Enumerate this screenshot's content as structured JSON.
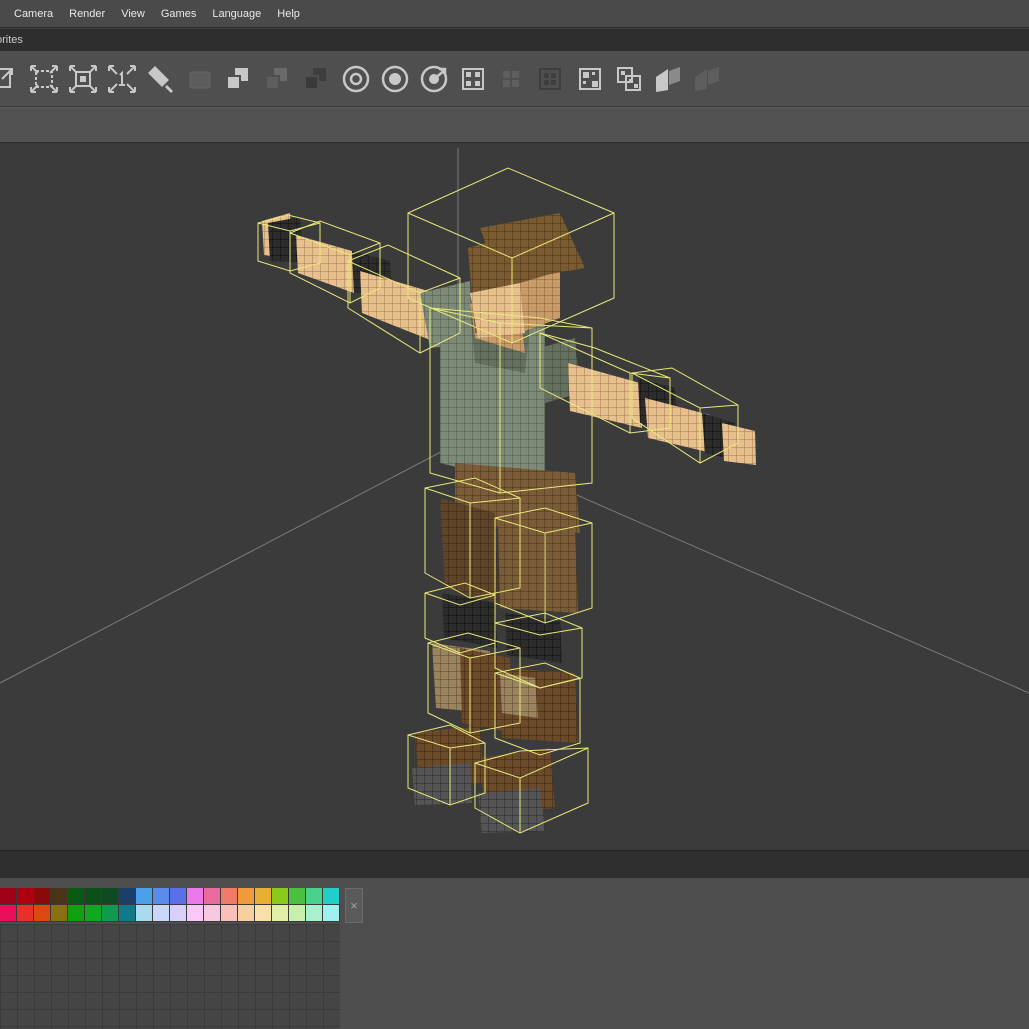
{
  "menubar": {
    "items": [
      "Camera",
      "Render",
      "View",
      "Games",
      "Language",
      "Help"
    ]
  },
  "tabbar": {
    "tab_label": "orites"
  },
  "toolbar": {
    "tools": [
      "fit-icon",
      "expand-icon",
      "scale-icon",
      "scale-one-icon",
      "brush-icon",
      "box-icon",
      "layers-icon",
      "layers-dim-icon",
      "layers-dark-icon",
      "ring-icon",
      "target-icon",
      "rotate-icon",
      "grid-select-icon",
      "grid-dim-icon",
      "grid-dark-icon",
      "grid-corner-icon",
      "grid-stack-icon",
      "plane-icon",
      "plane-dim-icon"
    ]
  },
  "palette": {
    "row1": [
      "#a00018",
      "#b00010",
      "#8a0a0a",
      "#4a3418",
      "#0a5a14",
      "#0a5018",
      "#0e4a22",
      "#18406a",
      "#4aa0ea",
      "#5a8aea",
      "#5a70ea",
      "#ea7aea",
      "#ea6a9a",
      "#f07a6a",
      "#f09a3a",
      "#e8b030",
      "#8aca1a",
      "#4ac040",
      "#4ad28a",
      "#20d0c8"
    ],
    "row2": [
      "#e8105a",
      "#e8302a",
      "#d84a10",
      "#8a7010",
      "#10a010",
      "#10a820",
      "#109a50",
      "#107a8a",
      "#aadaf0",
      "#c8d8f8",
      "#d8d0f8",
      "#f8c8f8",
      "#f8c8e0",
      "#f8c0b8",
      "#f8d0a0",
      "#f8e0a8",
      "#e0f0a8",
      "#c8f0a8",
      "#a8f0d0",
      "#a0f0f0"
    ],
    "clear_label": "×",
    "colors": {
      "panel": "#4e4e4e",
      "cell": "#454545"
    }
  },
  "colors": {
    "outline": "#e8e87a",
    "skin": "#e8c08e",
    "shirt": "#7e8a78",
    "pants": "#7a5c38",
    "boot": "#6a4a28",
    "hair": "#7a5a30",
    "sock": "#2a2a2a"
  }
}
